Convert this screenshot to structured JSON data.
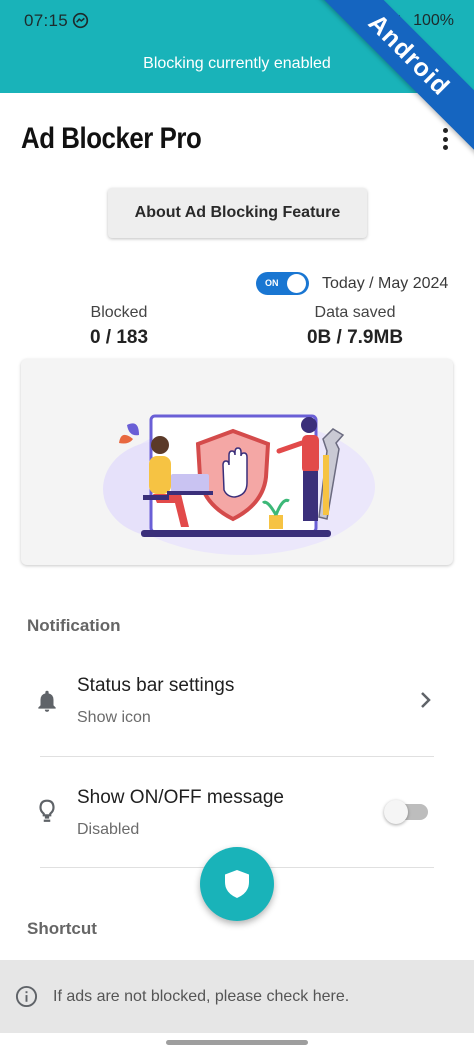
{
  "status_bar": {
    "time": "07:15",
    "battery": "100%"
  },
  "banner": {
    "text": "Blocking currently enabled"
  },
  "ribbon": {
    "text": "Android"
  },
  "header": {
    "title": "Ad Blocker Pro"
  },
  "about_button": {
    "label": "About Ad Blocking Feature"
  },
  "summary": {
    "toggle_label": "ON",
    "period": "Today / May 2024",
    "blocked_label": "Blocked",
    "blocked_value": "0 / 183",
    "data_saved_label": "Data saved",
    "data_saved_value": "0B / 7.9MB"
  },
  "notification": {
    "section_title": "Notification",
    "items": [
      {
        "title": "Status bar settings",
        "subtitle": "Show icon"
      },
      {
        "title": "Show ON/OFF message",
        "subtitle": "Disabled"
      }
    ]
  },
  "shortcut": {
    "section_title": "Shortcut"
  },
  "bottom_info": {
    "text": "If ads are not blocked, please check here."
  },
  "colors": {
    "teal": "#19b3b9",
    "blue": "#1976d2",
    "ribbon": "#1565c0"
  }
}
